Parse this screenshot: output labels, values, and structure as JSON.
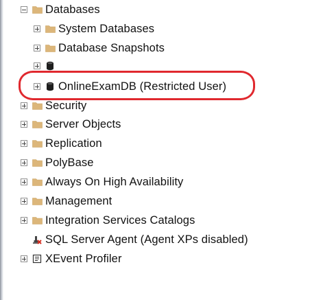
{
  "tree": {
    "databases": {
      "label": "Databases",
      "icon": "folder-icon",
      "state": "expanded",
      "children": [
        {
          "label": "System Databases",
          "icon": "folder-icon"
        },
        {
          "label": "Database Snapshots",
          "icon": "folder-icon"
        },
        {
          "label": "",
          "icon": "database-icon"
        },
        {
          "label": "OnlineExamDB (Restricted User)",
          "icon": "database-icon"
        }
      ]
    },
    "items": [
      {
        "label": "Security",
        "icon": "folder-icon"
      },
      {
        "label": "Server Objects",
        "icon": "folder-icon"
      },
      {
        "label": "Replication",
        "icon": "folder-icon"
      },
      {
        "label": "PolyBase",
        "icon": "folder-icon"
      },
      {
        "label": "Always On High Availability",
        "icon": "folder-icon"
      },
      {
        "label": "Management",
        "icon": "folder-icon"
      },
      {
        "label": "Integration Services Catalogs",
        "icon": "folder-icon"
      },
      {
        "label": "SQL Server Agent (Agent XPs disabled)",
        "icon": "sql-agent-disabled-icon"
      },
      {
        "label": "XEvent Profiler",
        "icon": "xevent-profiler-icon"
      }
    ]
  },
  "colors": {
    "folder": "#dcb67a",
    "highlight": "#e0282e",
    "database": "#1e1e1e"
  }
}
